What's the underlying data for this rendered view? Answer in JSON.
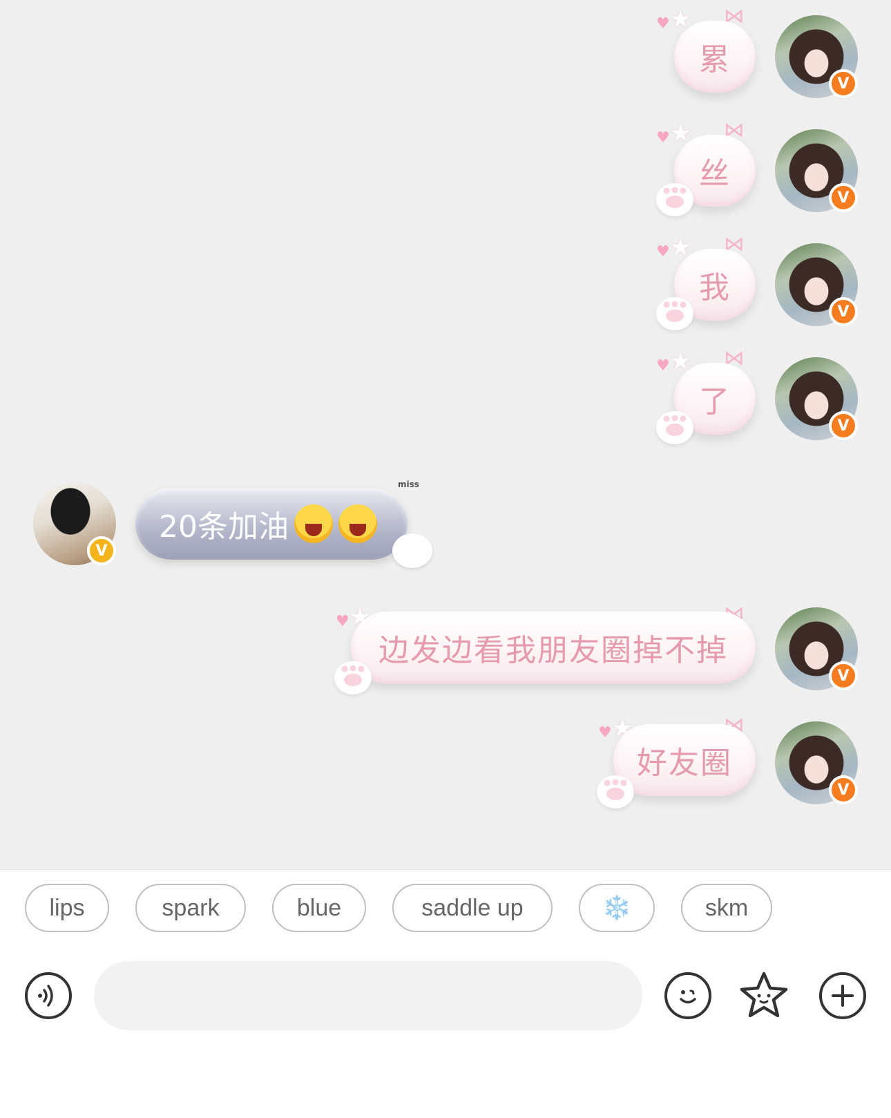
{
  "messages": [
    {
      "sender": "self",
      "text": "累",
      "badge": "V"
    },
    {
      "sender": "self",
      "text": "丝",
      "badge": "V"
    },
    {
      "sender": "self",
      "text": "我",
      "badge": "V"
    },
    {
      "sender": "self",
      "text": "了",
      "badge": "V"
    },
    {
      "sender": "other",
      "text": "20条加油",
      "emoji_count": 2,
      "emoji_name": "cheering-face-emoji",
      "deco_text": "miss",
      "badge": "V"
    },
    {
      "sender": "self",
      "text": "边发边看我朋友圈掉不掉",
      "badge": "V"
    },
    {
      "sender": "self",
      "text": "好友圈",
      "badge": "V"
    }
  ],
  "quick_replies": [
    {
      "label": "lips"
    },
    {
      "label": "spark"
    },
    {
      "label": "blue"
    },
    {
      "label": "saddle up"
    },
    {
      "label": "❄️"
    },
    {
      "label": "skm"
    }
  ],
  "input_bar": {
    "value": "",
    "voice_icon": "voice-icon",
    "emoji_icon": "emoji-icon",
    "sticker_icon": "star-sticker-icon",
    "plus_icon": "plus-icon"
  },
  "colors": {
    "self_bubble_text": "#e59ab0",
    "other_bubble_text": "#ffffff",
    "badge_orange": "#f57c1f",
    "badge_gold": "#f3b51b",
    "chat_bg": "#efefef"
  }
}
